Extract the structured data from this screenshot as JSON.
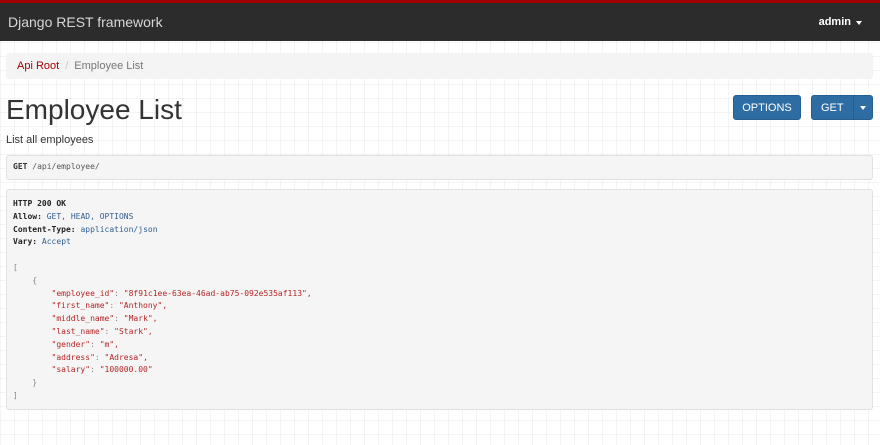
{
  "navbar": {
    "brand": "Django REST framework",
    "user": "admin"
  },
  "breadcrumb": {
    "root": "Api Root",
    "separator": "/",
    "current": "Employee List"
  },
  "page": {
    "title": "Employee List",
    "description": "List all employees"
  },
  "buttons": {
    "options": "OPTIONS",
    "get": "GET"
  },
  "request": {
    "method": "GET",
    "path": "/api/employee/"
  },
  "response": {
    "status": "HTTP 200 OK",
    "headers": [
      {
        "key": "Allow:",
        "value": "GET, HEAD, OPTIONS"
      },
      {
        "key": "Content-Type:",
        "value": "application/json"
      },
      {
        "key": "Vary:",
        "value": "Accept"
      }
    ],
    "body": {
      "open_array": "[",
      "open_object": "{",
      "fields": [
        {
          "key": "\"employee_id\"",
          "value": "\"8f91c1ee-63ea-46ad-ab75-092e535af113\","
        },
        {
          "key": "\"first_name\"",
          "value": "\"Anthony\","
        },
        {
          "key": "\"middle_name\"",
          "value": "\"Mark\","
        },
        {
          "key": "\"last_name\"",
          "value": "\"Stark\","
        },
        {
          "key": "\"gender\"",
          "value": "\"m\","
        },
        {
          "key": "\"address\"",
          "value": "\"Adresa\","
        },
        {
          "key": "\"salary\"",
          "value": "\"100000.00\""
        }
      ],
      "close_object": "}",
      "close_array": "]"
    }
  },
  "colors": {
    "navbar_bg": "#2c2c2c",
    "accent_red": "#a30000",
    "button_blue": "#2e6da4"
  }
}
